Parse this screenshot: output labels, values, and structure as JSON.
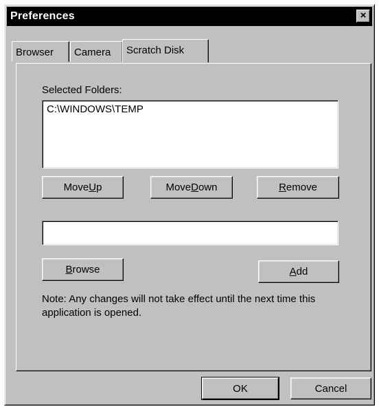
{
  "window": {
    "title": "Preferences",
    "close_label": "×"
  },
  "tabs": [
    {
      "label": "Browser",
      "active": false
    },
    {
      "label": "Camera",
      "active": false
    },
    {
      "label": "Scratch Disk",
      "active": true
    }
  ],
  "panel": {
    "selected_folders_label": "Selected Folders:",
    "folders": [
      "C:\\WINDOWS\\TEMP"
    ],
    "move_up": {
      "pre": "Move ",
      "ul": "U",
      "post": "p"
    },
    "move_down": {
      "pre": "Move ",
      "ul": "D",
      "post": "own"
    },
    "remove": {
      "pre": "",
      "ul": "R",
      "post": "emove"
    },
    "path_input_value": "",
    "browse": {
      "pre": "",
      "ul": "B",
      "post": "rowse"
    },
    "add": {
      "pre": "",
      "ul": "A",
      "post": "dd"
    },
    "note": "Note: Any changes will not take effect until the next time this application is opened."
  },
  "footer": {
    "ok_label": "OK",
    "cancel_label": "Cancel"
  }
}
